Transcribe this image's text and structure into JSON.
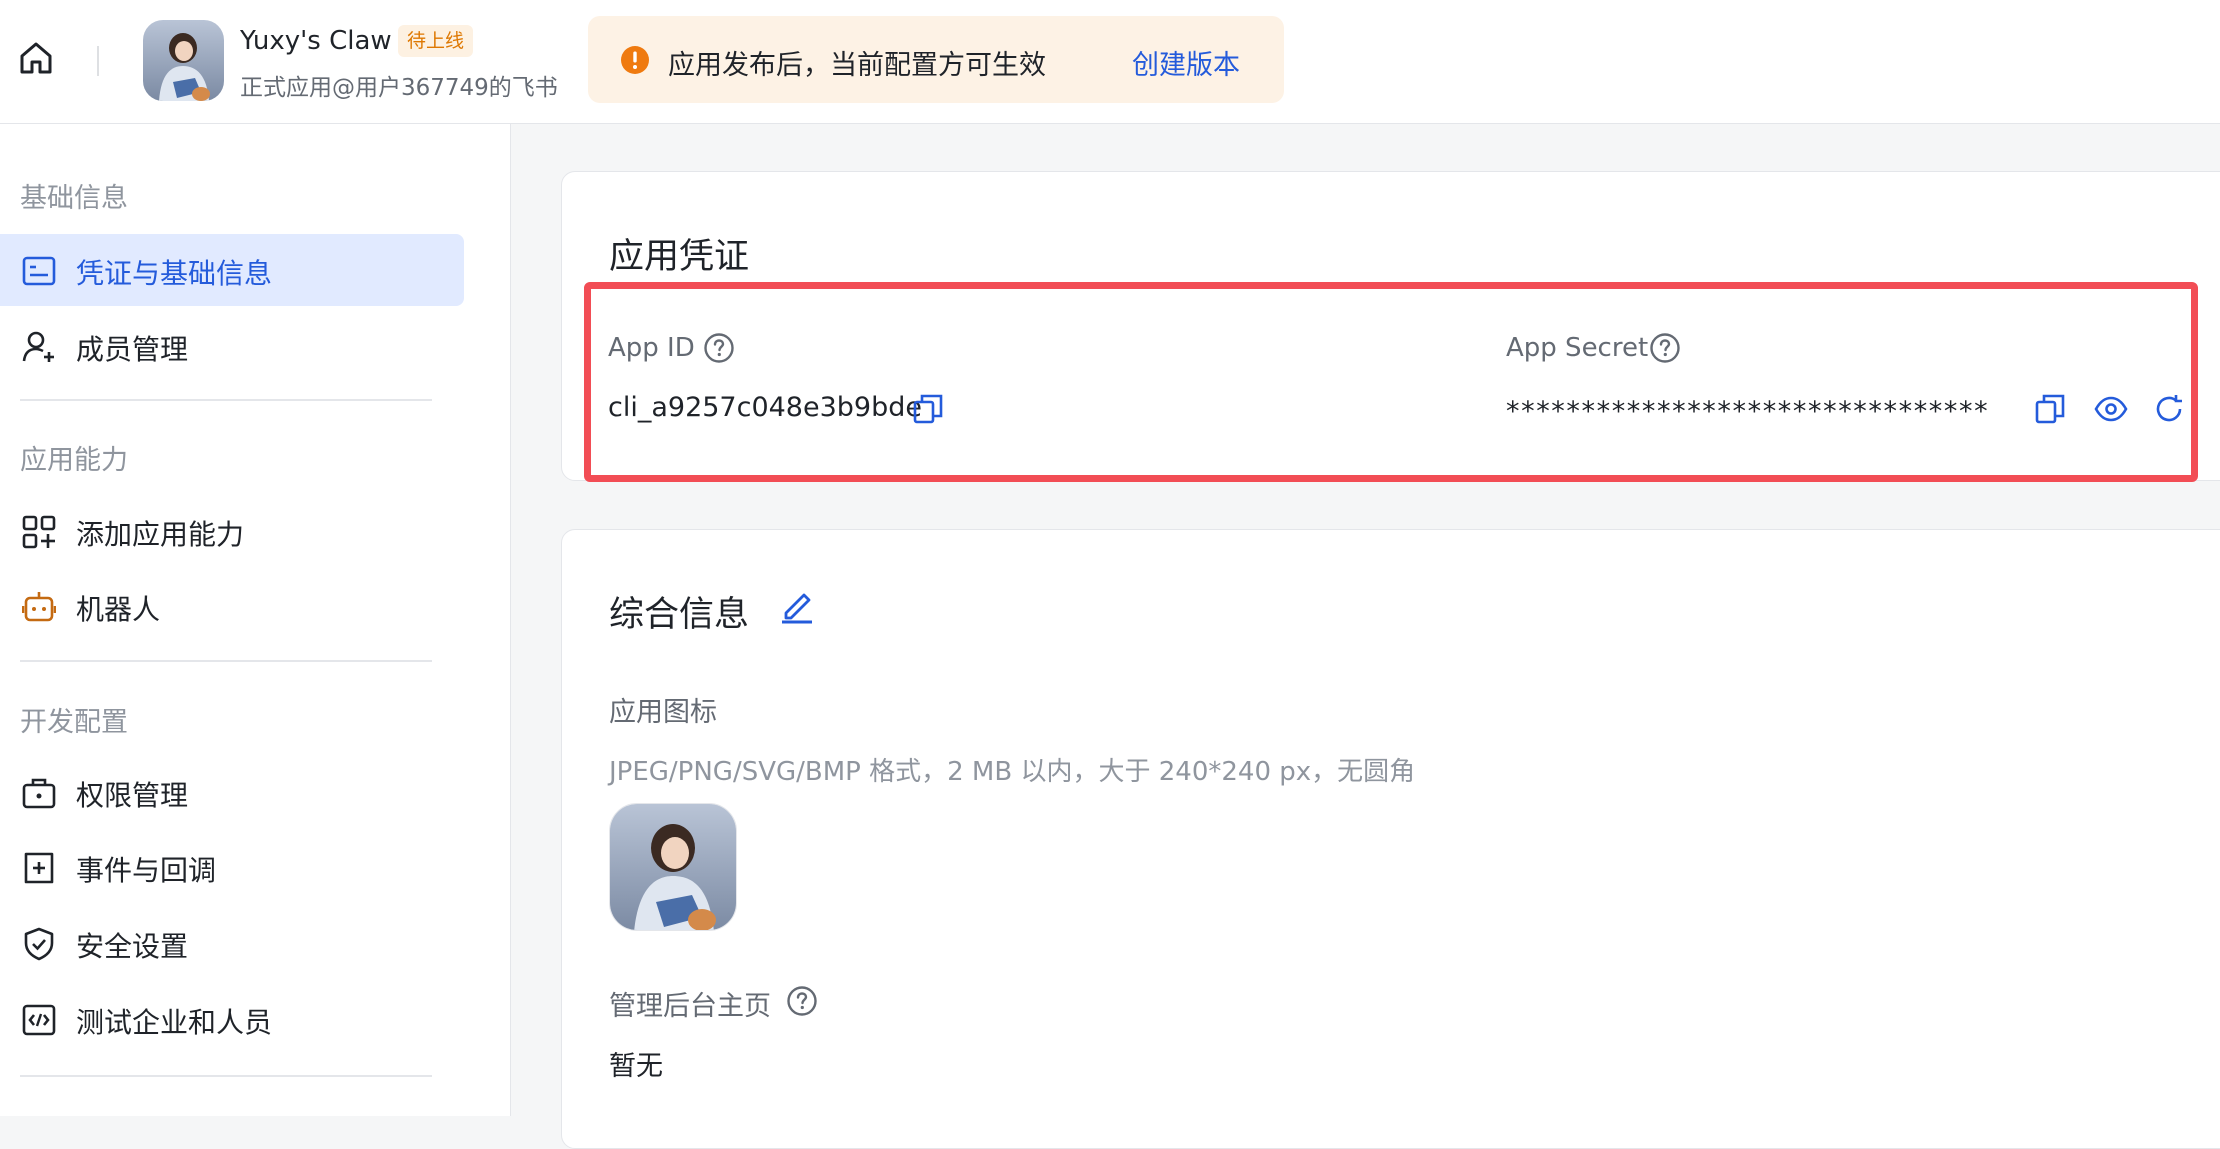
{
  "header": {
    "home_icon": "home-icon",
    "app_name": "Yuxy's Claw",
    "status_badge": "待上线",
    "app_owner": "正式应用@用户367749的飞书",
    "notice": {
      "icon": "warning-circle-icon",
      "text": "应用发布后，当前配置方可生效",
      "link": "创建版本"
    }
  },
  "sidebar": {
    "groups": [
      {
        "title": "基础信息",
        "items": [
          {
            "label": "凭证与基础信息",
            "icon": "credential-card-icon",
            "active": true
          },
          {
            "label": "成员管理",
            "icon": "user-add-icon",
            "active": false
          }
        ]
      },
      {
        "title": "应用能力",
        "items": [
          {
            "label": "添加应用能力",
            "icon": "apps-add-icon",
            "active": false
          },
          {
            "label": "机器人",
            "icon": "robot-icon",
            "active": false
          }
        ]
      },
      {
        "title": "开发配置",
        "items": [
          {
            "label": "权限管理",
            "icon": "permission-bag-icon",
            "active": false
          },
          {
            "label": "事件与回调",
            "icon": "event-plus-icon",
            "active": false
          },
          {
            "label": "安全设置",
            "icon": "shield-check-icon",
            "active": false
          },
          {
            "label": "测试企业和人员",
            "icon": "code-test-icon",
            "active": false
          }
        ]
      }
    ]
  },
  "credentials": {
    "title": "应用凭证",
    "app_id_label": "App ID",
    "app_id_value": "cli_a9257c048e3b9bde",
    "app_secret_label": "App Secret",
    "app_secret_value": "********************************"
  },
  "general": {
    "title": "综合信息",
    "icon_label": "应用图标",
    "icon_hint": "JPEG/PNG/SVG/BMP 格式，2 MB 以内，大于 240*240 px，无圆角",
    "homepage_label": "管理后台主页",
    "homepage_value": "暂无"
  },
  "colors": {
    "accent": "#245bdb",
    "active_bg": "#e1eaff",
    "highlight_border": "#f24d55",
    "badge_bg": "#fdf1e2",
    "badge_text": "#de7802",
    "notice_bg": "#fdf2e5",
    "notice_icon": "#ef7a0f"
  }
}
